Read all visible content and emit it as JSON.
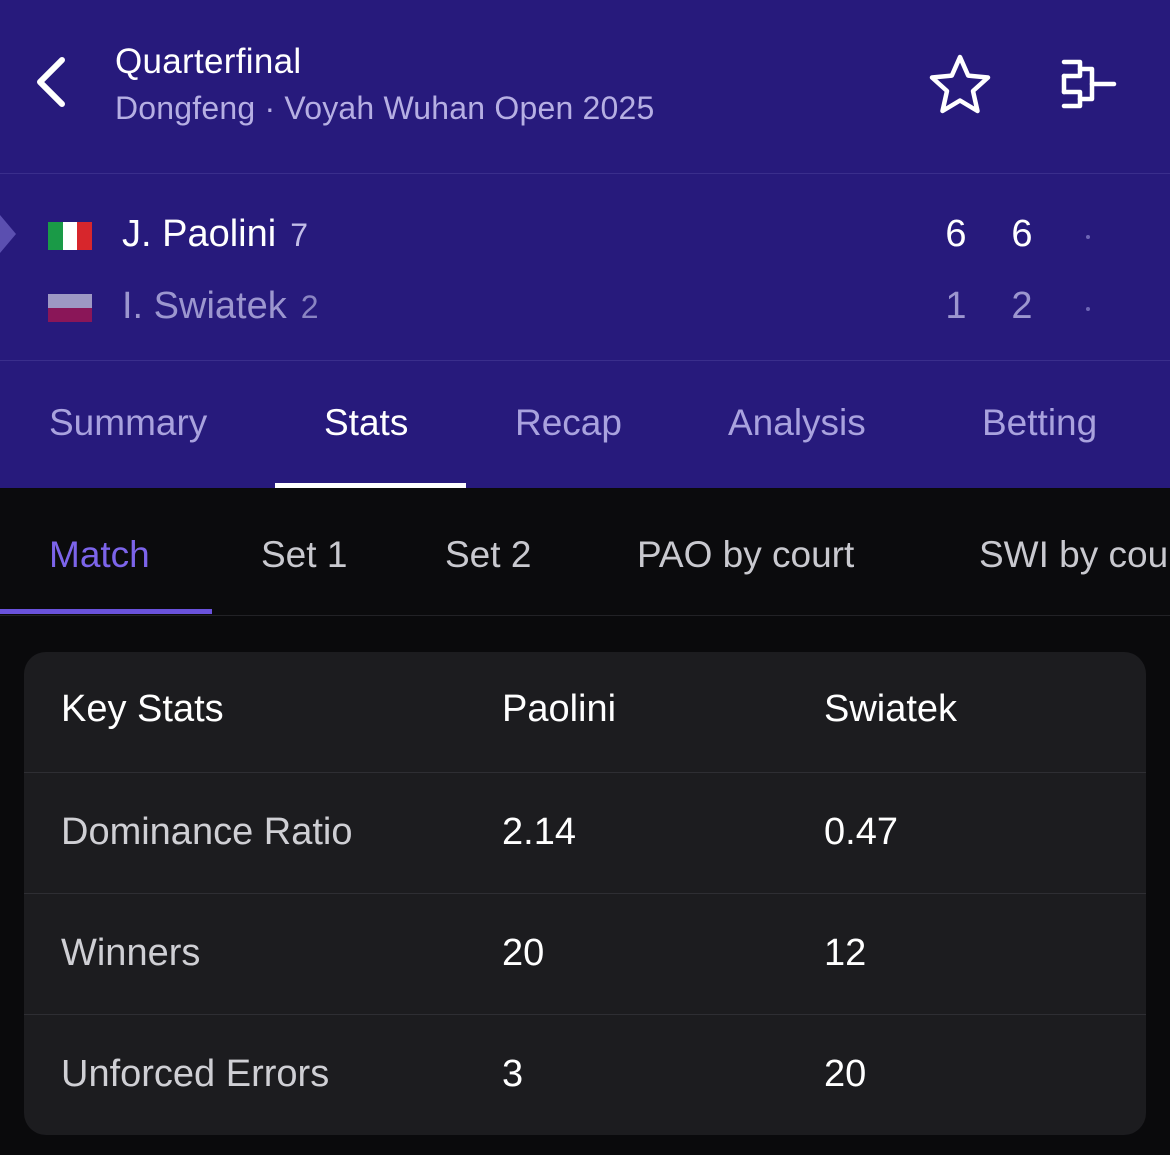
{
  "header": {
    "title": "Quarterfinal",
    "subtitle": "Dongfeng · Voyah Wuhan Open 2025",
    "icons": [
      "chevron-left-icon",
      "star-icon",
      "bracket-icon"
    ]
  },
  "match": {
    "players": [
      {
        "name": "J. Paolini",
        "seed": "7",
        "flag": "italy",
        "sets": [
          "6",
          "6"
        ]
      },
      {
        "name": "I. Swiatek",
        "seed": "2",
        "flag": "poland",
        "sets": [
          "1",
          "2"
        ]
      }
    ]
  },
  "tabs": [
    {
      "label": "Summary"
    },
    {
      "label": "Stats"
    },
    {
      "label": "Recap"
    },
    {
      "label": "Analysis"
    },
    {
      "label": "Betting"
    }
  ],
  "active_tab": "Stats",
  "subtabs": [
    {
      "label": "Match"
    },
    {
      "label": "Set 1"
    },
    {
      "label": "Set 2"
    },
    {
      "label": "PAO by court"
    },
    {
      "label": "SWI by court"
    }
  ],
  "active_subtab": "Match",
  "stats": {
    "headers": [
      "Key Stats",
      "Paolini",
      "Swiatek"
    ],
    "rows": [
      {
        "label": "Dominance Ratio",
        "paolini": "2.14",
        "swiatek": "0.47"
      },
      {
        "label": "Winners",
        "paolini": "20",
        "swiatek": "12"
      },
      {
        "label": "Unforced Errors",
        "paolini": "3",
        "swiatek": "20"
      }
    ]
  },
  "colors": {
    "header_bg": "#271a7c",
    "accent": "#7c64ea",
    "page_bg": "#0a0a0c",
    "card_bg": "#1c1c1f"
  }
}
